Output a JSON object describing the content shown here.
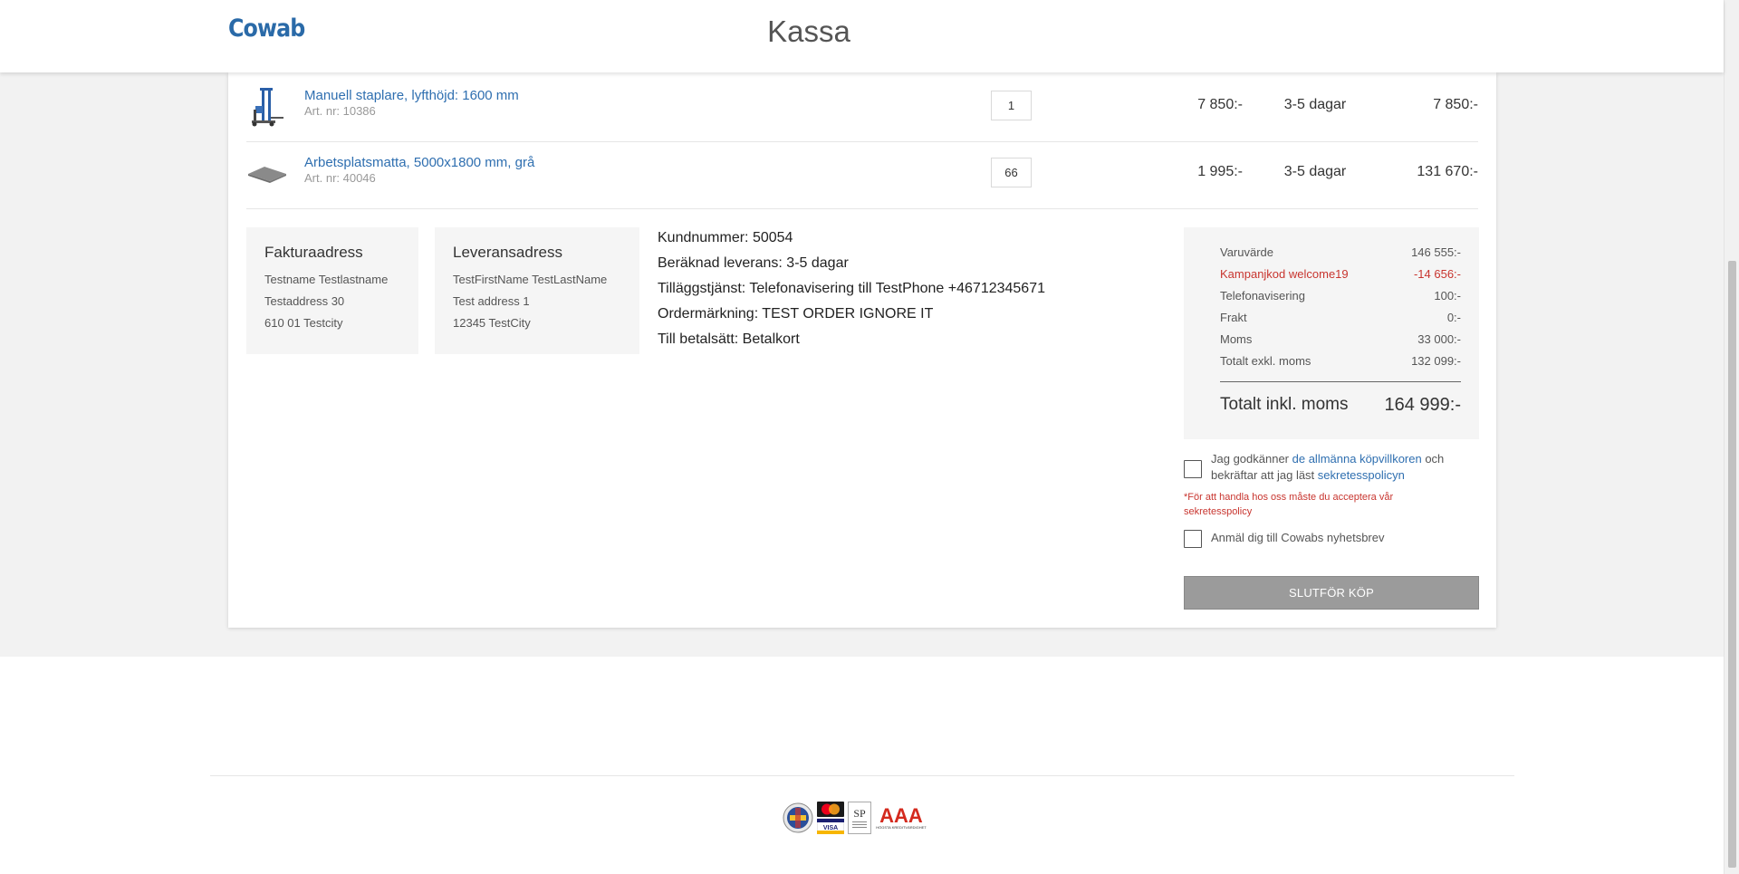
{
  "header": {
    "logo": "Cowab",
    "title": "Kassa"
  },
  "cart": {
    "items": [
      {
        "name": "Manuell staplare, lyfthöjd: 1600 mm",
        "art": "Art. nr: 10386",
        "qty": "1",
        "price": "7 850:-",
        "delivery": "3-5 dagar",
        "total": "7 850:-",
        "icon": "stacker-icon"
      },
      {
        "name": "Arbetsplatsmatta, 5000x1800 mm, grå",
        "art": "Art. nr: 40046",
        "qty": "66",
        "price": "1 995:-",
        "delivery": "3-5 dagar",
        "total": "131 670:-",
        "icon": "mat-icon"
      }
    ]
  },
  "billing": {
    "title": "Fakturaadress",
    "lines": [
      "Testname Testlastname",
      "Testaddress 30",
      "610 01 Testcity"
    ]
  },
  "shipping": {
    "title": "Leveransadress",
    "lines": [
      "TestFirstName TestLastName",
      "Test address 1",
      "12345 TestCity"
    ]
  },
  "order_info": [
    "Kundnummer: 50054",
    "Beräknad leverans: 3-5 dagar",
    "Tilläggstjänst: Telefonavisering till TestPhone +46712345671",
    "Ordermärkning: TEST ORDER IGNORE IT",
    "Till betalsätt: Betalkort"
  ],
  "summary": {
    "rows": [
      {
        "label": "Varuvärde",
        "value": "146 555:-"
      },
      {
        "label": "Kampanjkod welcome19",
        "value": "-14 656:-"
      },
      {
        "label": "Telefonavisering",
        "value": "100:-"
      },
      {
        "label": "Frakt",
        "value": "0:-"
      },
      {
        "label": "Moms",
        "value": "33 000:-"
      },
      {
        "label": "Totalt exkl. moms",
        "value": "132 099:-"
      }
    ],
    "total_label": "Totalt inkl. moms",
    "total_value": "164 999:-"
  },
  "terms": {
    "text_before": "Jag godkänner ",
    "link1": "de allmänna köpvillkoren",
    "text_middle": " och bekräftar att jag läst ",
    "link2": "sekretesspolicyn",
    "warning": "*För att handla hos oss måste du acceptera vår sekretesspolicy",
    "newsletter": "Anmäl dig till Cowabs nyhetsbrev"
  },
  "submit_label": "SLUTFÖR KÖP",
  "footer": {
    "badges": [
      "va-badge-icon",
      "mastercard-visa-icon",
      "sp-certified-icon",
      "aaa-rating-icon"
    ],
    "aaa_text": "AAA",
    "aaa_sub": "HÖGSTA KREDITVÄRDIGHET"
  },
  "colors": {
    "brand": "#2a6aa8",
    "link": "#2f6fb0",
    "campaign": "#c8352f",
    "button": "#9b9b9b"
  }
}
